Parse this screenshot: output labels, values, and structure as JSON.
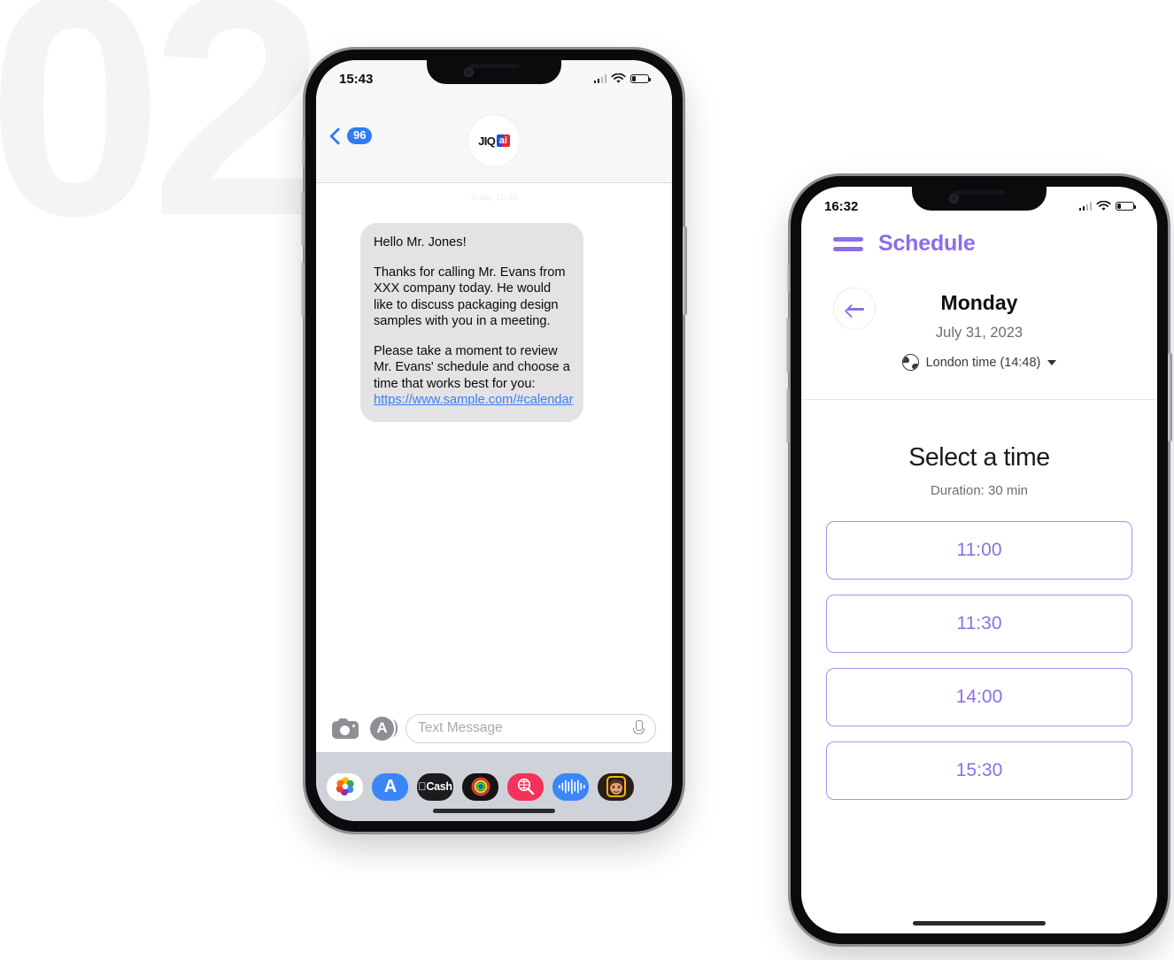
{
  "background": {
    "step_number": "02",
    "color": "#f3f4f4"
  },
  "phone_messages": {
    "status_bar": {
      "time": "15:43",
      "signal_icon": "cellular-bars-icon",
      "wifi_icon": "wifi-icon",
      "battery_icon": "battery-low-icon"
    },
    "header": {
      "back_label": "96",
      "back_chevron_icon": "chevron-left-icon",
      "contact_logo_primary": "JIQ",
      "contact_logo_badge": "ai",
      "accent_color": "#2f7bf5"
    },
    "conversation": {
      "timestamp": "Today 15:40",
      "message": {
        "greeting": "Hello Mr. Jones!",
        "paragraph_1": "Thanks for calling Mr. Evans from XXX company today. He would like to discuss packaging design samples with you in a meeting.",
        "paragraph_2_prefix": "Please take a moment to review Mr. Evans' schedule and choose a time that works best for you: ",
        "link_text": "https://www.sample.com/#calendar",
        "bubble_color": "#e3e3e5",
        "link_color": "#3b7ff0"
      }
    },
    "compose": {
      "camera_icon": "camera-icon",
      "app_store_icon": "app-store-icon",
      "placeholder": "Text Message",
      "mic_icon": "microphone-icon"
    },
    "app_drawer": [
      {
        "name": "photos-app-icon",
        "label": ""
      },
      {
        "name": "app-store-app-icon",
        "label": ""
      },
      {
        "name": "apple-cash-app-icon",
        "label": "Cash"
      },
      {
        "name": "music-app-icon",
        "label": ""
      },
      {
        "name": "images-search-app-icon",
        "label": ""
      },
      {
        "name": "voice-memo-app-icon",
        "label": ""
      },
      {
        "name": "memoji-app-icon",
        "label": ""
      }
    ]
  },
  "phone_schedule": {
    "status_bar": {
      "time": "16:32",
      "signal_icon": "cellular-bars-icon",
      "wifi_icon": "wifi-icon",
      "battery_icon": "battery-low-icon"
    },
    "app_bar": {
      "menu_icon": "hamburger-menu-icon",
      "title": "Schedule",
      "accent_color": "#8b6ee8"
    },
    "day": {
      "back_icon": "arrow-left-icon",
      "name": "Monday",
      "date": "July 31, 2023",
      "timezone_icon": "globe-icon",
      "timezone_label": "London time (14:48)",
      "timezone_caret_icon": "chevron-down-icon"
    },
    "select": {
      "title": "Select a time",
      "subtitle": "Duration: 30 min",
      "slots": [
        "11:00",
        "11:30",
        "14:00",
        "15:30"
      ]
    }
  }
}
